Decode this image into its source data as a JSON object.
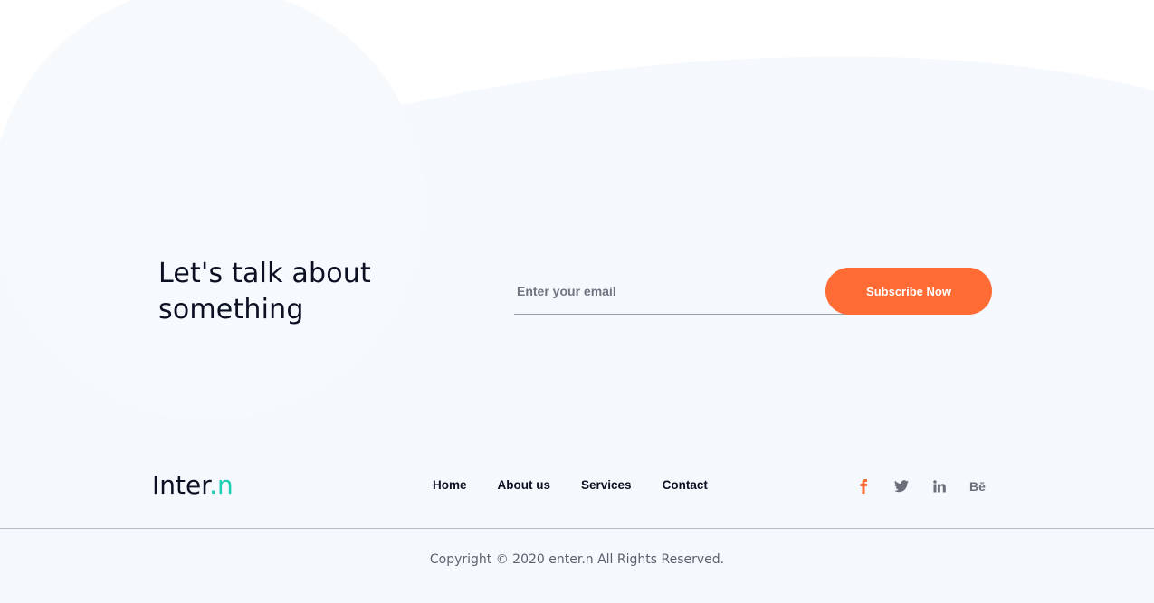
{
  "cta": {
    "headline_line1": "Let's talk about",
    "headline_line2": "something"
  },
  "subscribe": {
    "email_placeholder": "Enter your email",
    "email_value": "",
    "button_label": "Subscribe Now"
  },
  "footer": {
    "logo_text": "Inter",
    "logo_accent": ".n",
    "nav": [
      "Home",
      "About us",
      "Services",
      "Contact"
    ],
    "social": [
      {
        "name": "facebook-icon",
        "glyph": "f"
      },
      {
        "name": "twitter-icon",
        "glyph": "🐦"
      },
      {
        "name": "linkedin-icon",
        "glyph": "in"
      },
      {
        "name": "behance-icon",
        "glyph": "Bē"
      }
    ],
    "copyright": "Copyright © 2020 enter.n All Rights Reserved."
  },
  "colors": {
    "accent": "#ff6b35",
    "logo_accent": "#1ed0b3",
    "background_tint": "#f5f9fd",
    "text_dark": "#0b1023"
  }
}
